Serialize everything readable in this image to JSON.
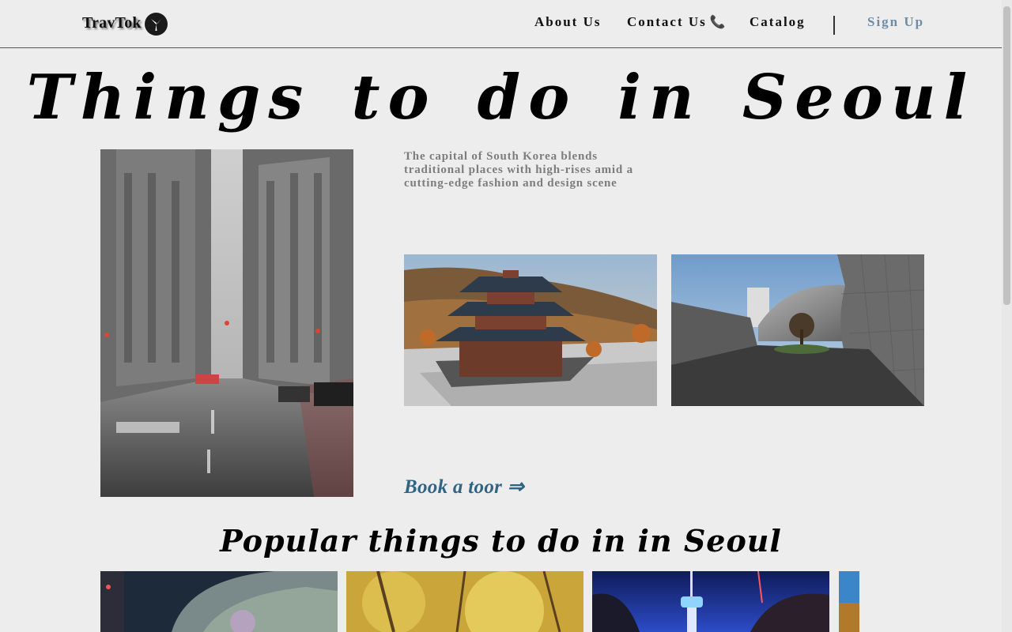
{
  "header": {
    "brand": "TravTok",
    "nav": {
      "about": "About Us",
      "contact": "Contact Us",
      "catalog": "Catalog",
      "signup": "Sign Up"
    }
  },
  "hero": {
    "title": "Things to do in Seoul",
    "description": "The capital of South Korea blends traditional places with high-rises amid a cutting-edge fashion and design scene",
    "cta": "Book a toor ⇒"
  },
  "popular": {
    "title": "Popular things to do in in Seoul"
  },
  "colors": {
    "background": "#ededed",
    "accent": "#2f6485",
    "signup": "#6e8ca6",
    "description": "#7d7d7d"
  },
  "icons": {
    "logo": "compass-logo-icon",
    "contact": "phone-icon"
  }
}
